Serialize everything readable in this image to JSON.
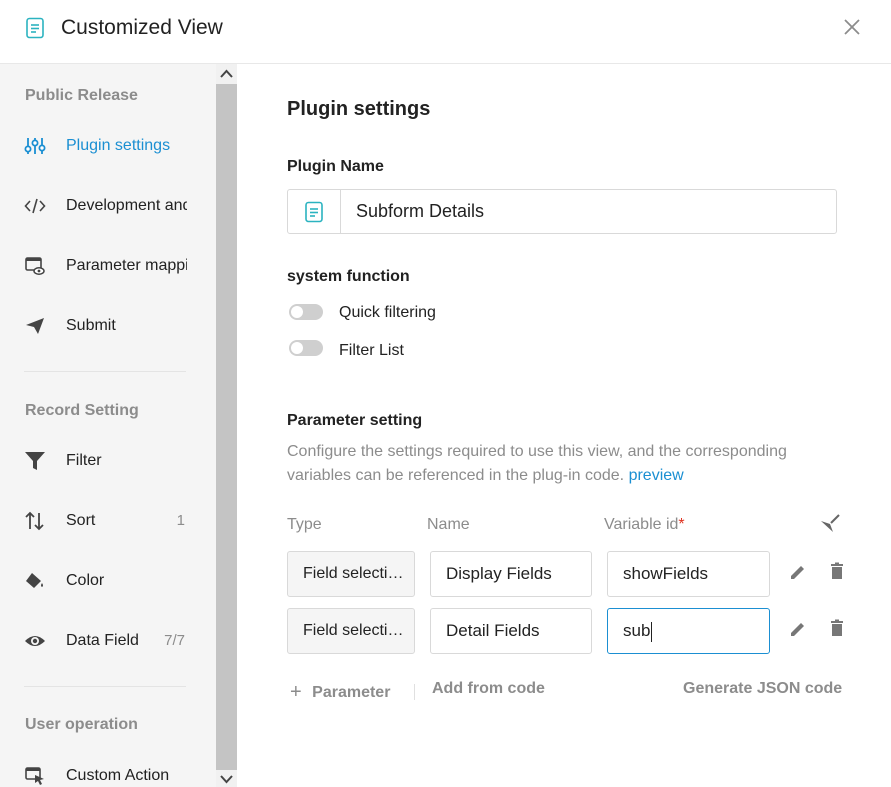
{
  "header": {
    "title": "Customized View"
  },
  "sidebar": {
    "groups": [
      {
        "title": "Public Release"
      },
      {
        "title": "Record Setting"
      },
      {
        "title": "User operation"
      }
    ],
    "items": [
      {
        "label": "Plugin settings",
        "icon": "sliders-icon",
        "active": true
      },
      {
        "label": "Development and",
        "icon": "code-icon"
      },
      {
        "label": "Parameter mapping",
        "icon": "parameter-mapping-icon"
      },
      {
        "label": "Submit",
        "icon": "send-icon"
      },
      {
        "label": "Filter",
        "icon": "filter-icon"
      },
      {
        "label": "Sort",
        "icon": "sort-icon",
        "count": "1"
      },
      {
        "label": "Color",
        "icon": "paint-bucket-icon"
      },
      {
        "label": "Data Field",
        "icon": "eye-icon",
        "count": "7/7"
      },
      {
        "label": "Custom Action",
        "icon": "cursor-window-icon"
      }
    ]
  },
  "main": {
    "title": "Plugin settings",
    "plugin_name_label": "Plugin Name",
    "plugin_name_value": "Subform Details",
    "system_function_label": "system function",
    "toggles": [
      {
        "label": "Quick filtering",
        "on": false
      },
      {
        "label": "Filter List",
        "on": false
      }
    ],
    "parameter_setting_label": "Parameter setting",
    "description": "Configure the settings required to use this view, and the corresponding variables can be referenced in the plug-in code.",
    "preview_link": "preview",
    "columns": {
      "type": "Type",
      "name": "Name",
      "variable_id": "Variable id",
      "required_mark": "*"
    },
    "rows": [
      {
        "type": "Field selection",
        "name": "Display Fields",
        "variable_id": "showFields"
      },
      {
        "type": "Field selection",
        "name": "Detail Fields",
        "variable_id": "sub"
      }
    ],
    "footer": {
      "add_parameter": "Parameter",
      "add_from_code": "Add from code",
      "generate_json": "Generate JSON code"
    }
  },
  "colors": {
    "accent": "#1b8fd2",
    "icon_teal": "#2bb3c0",
    "muted": "#8c8c8c",
    "required": "#e0301e"
  }
}
